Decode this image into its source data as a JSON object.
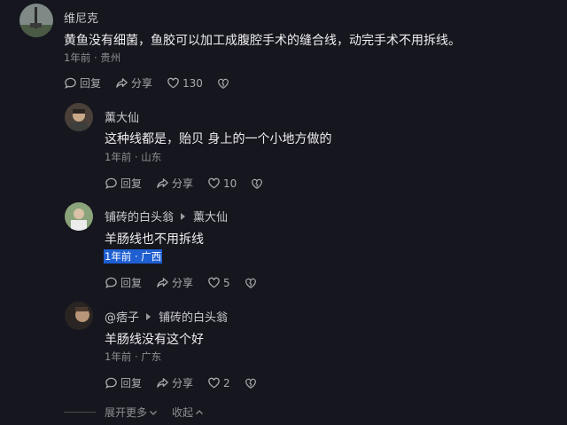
{
  "comments": [
    {
      "author": "维尼克",
      "text": "黄鱼没有细菌，鱼胶可以加工成腹腔手术的缝合线，动完手术不用拆线。",
      "meta": "1年前 · 贵州",
      "reply_label": "回复",
      "share_label": "分享",
      "likes": "130"
    },
    {
      "author": "薰大仙",
      "text": "这种线都是，贻贝 身上的一个小地方做的",
      "meta": "1年前 · 山东",
      "reply_label": "回复",
      "share_label": "分享",
      "likes": "10"
    },
    {
      "author": "铺砖的白头翁",
      "reply_to": "薰大仙",
      "text": "羊肠线也不用拆线",
      "meta": "1年前 · 广西",
      "reply_label": "回复",
      "share_label": "分享",
      "likes": "5"
    },
    {
      "author": "@痞子",
      "reply_to": "铺砖的白头翁",
      "text": "羊肠线没有这个好",
      "meta": "1年前 · 广东",
      "reply_label": "回复",
      "share_label": "分享",
      "likes": "2"
    }
  ],
  "footer": {
    "expand_label": "展开更多",
    "collapse_label": "收起"
  },
  "colors": {
    "background": "#16161e",
    "highlight": "#1f5fd1"
  }
}
